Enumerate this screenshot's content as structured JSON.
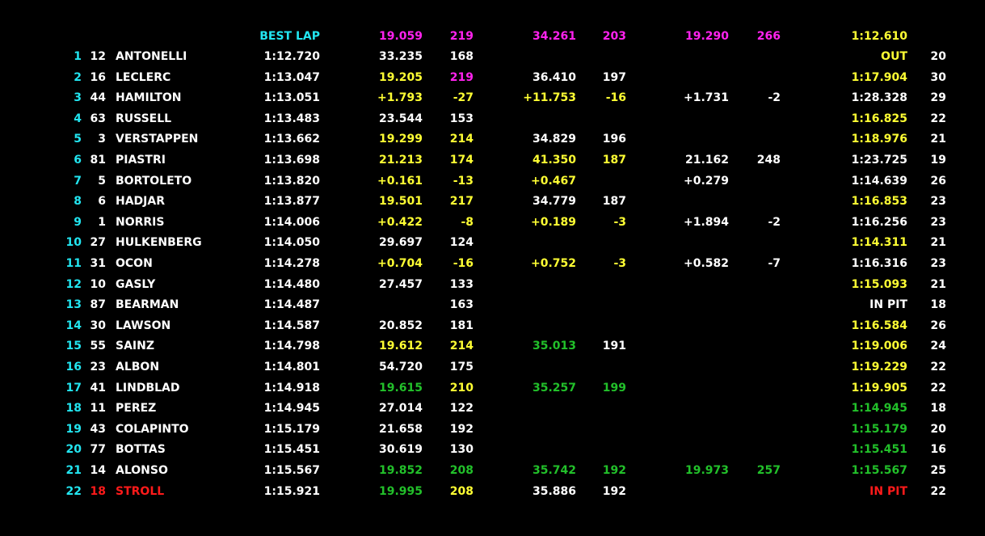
{
  "colors": {
    "background": "#000000",
    "white": "#ffffff",
    "yellow": "#ffff33",
    "green": "#22c02a",
    "purple": "#ff22ee",
    "cyan": "#22e5f0",
    "red": "#ff1a1a"
  },
  "header": {
    "best_lap_label": {
      "v": "BEST LAP",
      "c": "c"
    },
    "s1": {
      "v": "19.059",
      "c": "p"
    },
    "s1_speed": {
      "v": "219",
      "c": "p"
    },
    "s2": {
      "v": "34.261",
      "c": "p"
    },
    "s2_speed": {
      "v": "203",
      "c": "p"
    },
    "s3": {
      "v": "19.290",
      "c": "p"
    },
    "s3_speed": {
      "v": "266",
      "c": "p"
    },
    "last": {
      "v": "1:12.610",
      "c": "y"
    }
  },
  "rows": [
    {
      "pos": {
        "v": "1",
        "c": "c"
      },
      "num": {
        "v": "12",
        "c": "w"
      },
      "name": {
        "v": "ANTONELLI",
        "c": "w"
      },
      "best": {
        "v": "1:12.720",
        "c": "w"
      },
      "s1": {
        "v": "33.235",
        "c": "w"
      },
      "s1_speed": {
        "v": "168",
        "c": "w"
      },
      "s2": {
        "v": "",
        "c": "w"
      },
      "s2_speed": {
        "v": "",
        "c": "w"
      },
      "s3": {
        "v": "",
        "c": "w"
      },
      "s3_speed": {
        "v": "",
        "c": "w"
      },
      "last": {
        "v": "OUT",
        "c": "y"
      },
      "laps": {
        "v": "20",
        "c": "w"
      }
    },
    {
      "pos": {
        "v": "2",
        "c": "c"
      },
      "num": {
        "v": "16",
        "c": "w"
      },
      "name": {
        "v": "LECLERC",
        "c": "w"
      },
      "best": {
        "v": "1:13.047",
        "c": "w"
      },
      "s1": {
        "v": "19.205",
        "c": "y"
      },
      "s1_speed": {
        "v": "219",
        "c": "p"
      },
      "s2": {
        "v": "36.410",
        "c": "w"
      },
      "s2_speed": {
        "v": "197",
        "c": "w"
      },
      "s3": {
        "v": "",
        "c": "w"
      },
      "s3_speed": {
        "v": "",
        "c": "w"
      },
      "last": {
        "v": "1:17.904",
        "c": "y"
      },
      "laps": {
        "v": "30",
        "c": "w"
      }
    },
    {
      "pos": {
        "v": "3",
        "c": "c"
      },
      "num": {
        "v": "44",
        "c": "w"
      },
      "name": {
        "v": "HAMILTON",
        "c": "w"
      },
      "best": {
        "v": "1:13.051",
        "c": "w"
      },
      "s1": {
        "v": "+1.793",
        "c": "y"
      },
      "s1_speed": {
        "v": "-27",
        "c": "y"
      },
      "s2": {
        "v": "+11.753",
        "c": "y"
      },
      "s2_speed": {
        "v": "-16",
        "c": "y"
      },
      "s3": {
        "v": "+1.731",
        "c": "w"
      },
      "s3_speed": {
        "v": "-2",
        "c": "w"
      },
      "last": {
        "v": "1:28.328",
        "c": "w"
      },
      "laps": {
        "v": "29",
        "c": "w"
      }
    },
    {
      "pos": {
        "v": "4",
        "c": "c"
      },
      "num": {
        "v": "63",
        "c": "w"
      },
      "name": {
        "v": "RUSSELL",
        "c": "w"
      },
      "best": {
        "v": "1:13.483",
        "c": "w"
      },
      "s1": {
        "v": "23.544",
        "c": "w"
      },
      "s1_speed": {
        "v": "153",
        "c": "w"
      },
      "s2": {
        "v": "",
        "c": "w"
      },
      "s2_speed": {
        "v": "",
        "c": "w"
      },
      "s3": {
        "v": "",
        "c": "w"
      },
      "s3_speed": {
        "v": "",
        "c": "w"
      },
      "last": {
        "v": "1:16.825",
        "c": "y"
      },
      "laps": {
        "v": "22",
        "c": "w"
      }
    },
    {
      "pos": {
        "v": "5",
        "c": "c"
      },
      "num": {
        "v": "3",
        "c": "w"
      },
      "name": {
        "v": "VERSTAPPEN",
        "c": "w"
      },
      "best": {
        "v": "1:13.662",
        "c": "w"
      },
      "s1": {
        "v": "19.299",
        "c": "y"
      },
      "s1_speed": {
        "v": "214",
        "c": "y"
      },
      "s2": {
        "v": "34.829",
        "c": "w"
      },
      "s2_speed": {
        "v": "196",
        "c": "w"
      },
      "s3": {
        "v": "",
        "c": "w"
      },
      "s3_speed": {
        "v": "",
        "c": "w"
      },
      "last": {
        "v": "1:18.976",
        "c": "y"
      },
      "laps": {
        "v": "21",
        "c": "w"
      }
    },
    {
      "pos": {
        "v": "6",
        "c": "c"
      },
      "num": {
        "v": "81",
        "c": "w"
      },
      "name": {
        "v": "PIASTRI",
        "c": "w"
      },
      "best": {
        "v": "1:13.698",
        "c": "w"
      },
      "s1": {
        "v": "21.213",
        "c": "y"
      },
      "s1_speed": {
        "v": "174",
        "c": "y"
      },
      "s2": {
        "v": "41.350",
        "c": "y"
      },
      "s2_speed": {
        "v": "187",
        "c": "y"
      },
      "s3": {
        "v": "21.162",
        "c": "w"
      },
      "s3_speed": {
        "v": "248",
        "c": "w"
      },
      "last": {
        "v": "1:23.725",
        "c": "w"
      },
      "laps": {
        "v": "19",
        "c": "w"
      }
    },
    {
      "pos": {
        "v": "7",
        "c": "c"
      },
      "num": {
        "v": "5",
        "c": "w"
      },
      "name": {
        "v": "BORTOLETO",
        "c": "w"
      },
      "best": {
        "v": "1:13.820",
        "c": "w"
      },
      "s1": {
        "v": "+0.161",
        "c": "y"
      },
      "s1_speed": {
        "v": "-13",
        "c": "y"
      },
      "s2": {
        "v": "+0.467",
        "c": "y"
      },
      "s2_speed": {
        "v": "",
        "c": "w"
      },
      "s3": {
        "v": "+0.279",
        "c": "w"
      },
      "s3_speed": {
        "v": "",
        "c": "w"
      },
      "last": {
        "v": "1:14.639",
        "c": "w"
      },
      "laps": {
        "v": "26",
        "c": "w"
      }
    },
    {
      "pos": {
        "v": "8",
        "c": "c"
      },
      "num": {
        "v": "6",
        "c": "w"
      },
      "name": {
        "v": "HADJAR",
        "c": "w"
      },
      "best": {
        "v": "1:13.877",
        "c": "w"
      },
      "s1": {
        "v": "19.501",
        "c": "y"
      },
      "s1_speed": {
        "v": "217",
        "c": "y"
      },
      "s2": {
        "v": "34.779",
        "c": "w"
      },
      "s2_speed": {
        "v": "187",
        "c": "w"
      },
      "s3": {
        "v": "",
        "c": "w"
      },
      "s3_speed": {
        "v": "",
        "c": "w"
      },
      "last": {
        "v": "1:16.853",
        "c": "y"
      },
      "laps": {
        "v": "23",
        "c": "w"
      }
    },
    {
      "pos": {
        "v": "9",
        "c": "c"
      },
      "num": {
        "v": "1",
        "c": "w"
      },
      "name": {
        "v": "NORRIS",
        "c": "w"
      },
      "best": {
        "v": "1:14.006",
        "c": "w"
      },
      "s1": {
        "v": "+0.422",
        "c": "y"
      },
      "s1_speed": {
        "v": "-8",
        "c": "y"
      },
      "s2": {
        "v": "+0.189",
        "c": "y"
      },
      "s2_speed": {
        "v": "-3",
        "c": "y"
      },
      "s3": {
        "v": "+1.894",
        "c": "w"
      },
      "s3_speed": {
        "v": "-2",
        "c": "w"
      },
      "last": {
        "v": "1:16.256",
        "c": "w"
      },
      "laps": {
        "v": "23",
        "c": "w"
      }
    },
    {
      "pos": {
        "v": "10",
        "c": "c"
      },
      "num": {
        "v": "27",
        "c": "w"
      },
      "name": {
        "v": "HULKENBERG",
        "c": "w"
      },
      "best": {
        "v": "1:14.050",
        "c": "w"
      },
      "s1": {
        "v": "29.697",
        "c": "w"
      },
      "s1_speed": {
        "v": "124",
        "c": "w"
      },
      "s2": {
        "v": "",
        "c": "w"
      },
      "s2_speed": {
        "v": "",
        "c": "w"
      },
      "s3": {
        "v": "",
        "c": "w"
      },
      "s3_speed": {
        "v": "",
        "c": "w"
      },
      "last": {
        "v": "1:14.311",
        "c": "y"
      },
      "laps": {
        "v": "21",
        "c": "w"
      }
    },
    {
      "pos": {
        "v": "11",
        "c": "c"
      },
      "num": {
        "v": "31",
        "c": "w"
      },
      "name": {
        "v": "OCON",
        "c": "w"
      },
      "best": {
        "v": "1:14.278",
        "c": "w"
      },
      "s1": {
        "v": "+0.704",
        "c": "y"
      },
      "s1_speed": {
        "v": "-16",
        "c": "y"
      },
      "s2": {
        "v": "+0.752",
        "c": "y"
      },
      "s2_speed": {
        "v": "-3",
        "c": "y"
      },
      "s3": {
        "v": "+0.582",
        "c": "w"
      },
      "s3_speed": {
        "v": "-7",
        "c": "w"
      },
      "last": {
        "v": "1:16.316",
        "c": "w"
      },
      "laps": {
        "v": "23",
        "c": "w"
      }
    },
    {
      "pos": {
        "v": "12",
        "c": "c"
      },
      "num": {
        "v": "10",
        "c": "w"
      },
      "name": {
        "v": "GASLY",
        "c": "w"
      },
      "best": {
        "v": "1:14.480",
        "c": "w"
      },
      "s1": {
        "v": "27.457",
        "c": "w"
      },
      "s1_speed": {
        "v": "133",
        "c": "w"
      },
      "s2": {
        "v": "",
        "c": "w"
      },
      "s2_speed": {
        "v": "",
        "c": "w"
      },
      "s3": {
        "v": "",
        "c": "w"
      },
      "s3_speed": {
        "v": "",
        "c": "w"
      },
      "last": {
        "v": "1:15.093",
        "c": "y"
      },
      "laps": {
        "v": "21",
        "c": "w"
      }
    },
    {
      "pos": {
        "v": "13",
        "c": "c"
      },
      "num": {
        "v": "87",
        "c": "w"
      },
      "name": {
        "v": "BEARMAN",
        "c": "w"
      },
      "best": {
        "v": "1:14.487",
        "c": "w"
      },
      "s1": {
        "v": "",
        "c": "w"
      },
      "s1_speed": {
        "v": "163",
        "c": "w"
      },
      "s2": {
        "v": "",
        "c": "w"
      },
      "s2_speed": {
        "v": "",
        "c": "w"
      },
      "s3": {
        "v": "",
        "c": "w"
      },
      "s3_speed": {
        "v": "",
        "c": "w"
      },
      "last": {
        "v": "IN PIT",
        "c": "w"
      },
      "laps": {
        "v": "18",
        "c": "w"
      }
    },
    {
      "pos": {
        "v": "14",
        "c": "c"
      },
      "num": {
        "v": "30",
        "c": "w"
      },
      "name": {
        "v": "LAWSON",
        "c": "w"
      },
      "best": {
        "v": "1:14.587",
        "c": "w"
      },
      "s1": {
        "v": "20.852",
        "c": "w"
      },
      "s1_speed": {
        "v": "181",
        "c": "w"
      },
      "s2": {
        "v": "",
        "c": "w"
      },
      "s2_speed": {
        "v": "",
        "c": "w"
      },
      "s3": {
        "v": "",
        "c": "w"
      },
      "s3_speed": {
        "v": "",
        "c": "w"
      },
      "last": {
        "v": "1:16.584",
        "c": "y"
      },
      "laps": {
        "v": "26",
        "c": "w"
      }
    },
    {
      "pos": {
        "v": "15",
        "c": "c"
      },
      "num": {
        "v": "55",
        "c": "w"
      },
      "name": {
        "v": "SAINZ",
        "c": "w"
      },
      "best": {
        "v": "1:14.798",
        "c": "w"
      },
      "s1": {
        "v": "19.612",
        "c": "y"
      },
      "s1_speed": {
        "v": "214",
        "c": "y"
      },
      "s2": {
        "v": "35.013",
        "c": "g"
      },
      "s2_speed": {
        "v": "191",
        "c": "w"
      },
      "s3": {
        "v": "",
        "c": "w"
      },
      "s3_speed": {
        "v": "",
        "c": "w"
      },
      "last": {
        "v": "1:19.006",
        "c": "y"
      },
      "laps": {
        "v": "24",
        "c": "w"
      }
    },
    {
      "pos": {
        "v": "16",
        "c": "c"
      },
      "num": {
        "v": "23",
        "c": "w"
      },
      "name": {
        "v": "ALBON",
        "c": "w"
      },
      "best": {
        "v": "1:14.801",
        "c": "w"
      },
      "s1": {
        "v": "54.720",
        "c": "w"
      },
      "s1_speed": {
        "v": "175",
        "c": "w"
      },
      "s2": {
        "v": "",
        "c": "w"
      },
      "s2_speed": {
        "v": "",
        "c": "w"
      },
      "s3": {
        "v": "",
        "c": "w"
      },
      "s3_speed": {
        "v": "",
        "c": "w"
      },
      "last": {
        "v": "1:19.229",
        "c": "y"
      },
      "laps": {
        "v": "22",
        "c": "w"
      }
    },
    {
      "pos": {
        "v": "17",
        "c": "c"
      },
      "num": {
        "v": "41",
        "c": "w"
      },
      "name": {
        "v": "LINDBLAD",
        "c": "w"
      },
      "best": {
        "v": "1:14.918",
        "c": "w"
      },
      "s1": {
        "v": "19.615",
        "c": "g"
      },
      "s1_speed": {
        "v": "210",
        "c": "y"
      },
      "s2": {
        "v": "35.257",
        "c": "g"
      },
      "s2_speed": {
        "v": "199",
        "c": "g"
      },
      "s3": {
        "v": "",
        "c": "w"
      },
      "s3_speed": {
        "v": "",
        "c": "w"
      },
      "last": {
        "v": "1:19.905",
        "c": "y"
      },
      "laps": {
        "v": "22",
        "c": "w"
      }
    },
    {
      "pos": {
        "v": "18",
        "c": "c"
      },
      "num": {
        "v": "11",
        "c": "w"
      },
      "name": {
        "v": "PEREZ",
        "c": "w"
      },
      "best": {
        "v": "1:14.945",
        "c": "w"
      },
      "s1": {
        "v": "27.014",
        "c": "w"
      },
      "s1_speed": {
        "v": "122",
        "c": "w"
      },
      "s2": {
        "v": "",
        "c": "w"
      },
      "s2_speed": {
        "v": "",
        "c": "w"
      },
      "s3": {
        "v": "",
        "c": "w"
      },
      "s3_speed": {
        "v": "",
        "c": "w"
      },
      "last": {
        "v": "1:14.945",
        "c": "g"
      },
      "laps": {
        "v": "18",
        "c": "w"
      }
    },
    {
      "pos": {
        "v": "19",
        "c": "c"
      },
      "num": {
        "v": "43",
        "c": "w"
      },
      "name": {
        "v": "COLAPINTO",
        "c": "w"
      },
      "best": {
        "v": "1:15.179",
        "c": "w"
      },
      "s1": {
        "v": "21.658",
        "c": "w"
      },
      "s1_speed": {
        "v": "192",
        "c": "w"
      },
      "s2": {
        "v": "",
        "c": "w"
      },
      "s2_speed": {
        "v": "",
        "c": "w"
      },
      "s3": {
        "v": "",
        "c": "w"
      },
      "s3_speed": {
        "v": "",
        "c": "w"
      },
      "last": {
        "v": "1:15.179",
        "c": "g"
      },
      "laps": {
        "v": "20",
        "c": "w"
      }
    },
    {
      "pos": {
        "v": "20",
        "c": "c"
      },
      "num": {
        "v": "77",
        "c": "w"
      },
      "name": {
        "v": "BOTTAS",
        "c": "w"
      },
      "best": {
        "v": "1:15.451",
        "c": "w"
      },
      "s1": {
        "v": "30.619",
        "c": "w"
      },
      "s1_speed": {
        "v": "130",
        "c": "w"
      },
      "s2": {
        "v": "",
        "c": "w"
      },
      "s2_speed": {
        "v": "",
        "c": "w"
      },
      "s3": {
        "v": "",
        "c": "w"
      },
      "s3_speed": {
        "v": "",
        "c": "w"
      },
      "last": {
        "v": "1:15.451",
        "c": "g"
      },
      "laps": {
        "v": "16",
        "c": "w"
      }
    },
    {
      "pos": {
        "v": "21",
        "c": "c"
      },
      "num": {
        "v": "14",
        "c": "w"
      },
      "name": {
        "v": "ALONSO",
        "c": "w"
      },
      "best": {
        "v": "1:15.567",
        "c": "w"
      },
      "s1": {
        "v": "19.852",
        "c": "g"
      },
      "s1_speed": {
        "v": "208",
        "c": "g"
      },
      "s2": {
        "v": "35.742",
        "c": "g"
      },
      "s2_speed": {
        "v": "192",
        "c": "g"
      },
      "s3": {
        "v": "19.973",
        "c": "g"
      },
      "s3_speed": {
        "v": "257",
        "c": "g"
      },
      "last": {
        "v": "1:15.567",
        "c": "g"
      },
      "laps": {
        "v": "25",
        "c": "w"
      }
    },
    {
      "pos": {
        "v": "22",
        "c": "c"
      },
      "num": {
        "v": "18",
        "c": "r"
      },
      "name": {
        "v": "STROLL",
        "c": "r"
      },
      "best": {
        "v": "1:15.921",
        "c": "w"
      },
      "s1": {
        "v": "19.995",
        "c": "g"
      },
      "s1_speed": {
        "v": "208",
        "c": "y"
      },
      "s2": {
        "v": "35.886",
        "c": "w"
      },
      "s2_speed": {
        "v": "192",
        "c": "w"
      },
      "s3": {
        "v": "",
        "c": "w"
      },
      "s3_speed": {
        "v": "",
        "c": "w"
      },
      "last": {
        "v": "IN PIT",
        "c": "r"
      },
      "laps": {
        "v": "22",
        "c": "w"
      }
    }
  ]
}
